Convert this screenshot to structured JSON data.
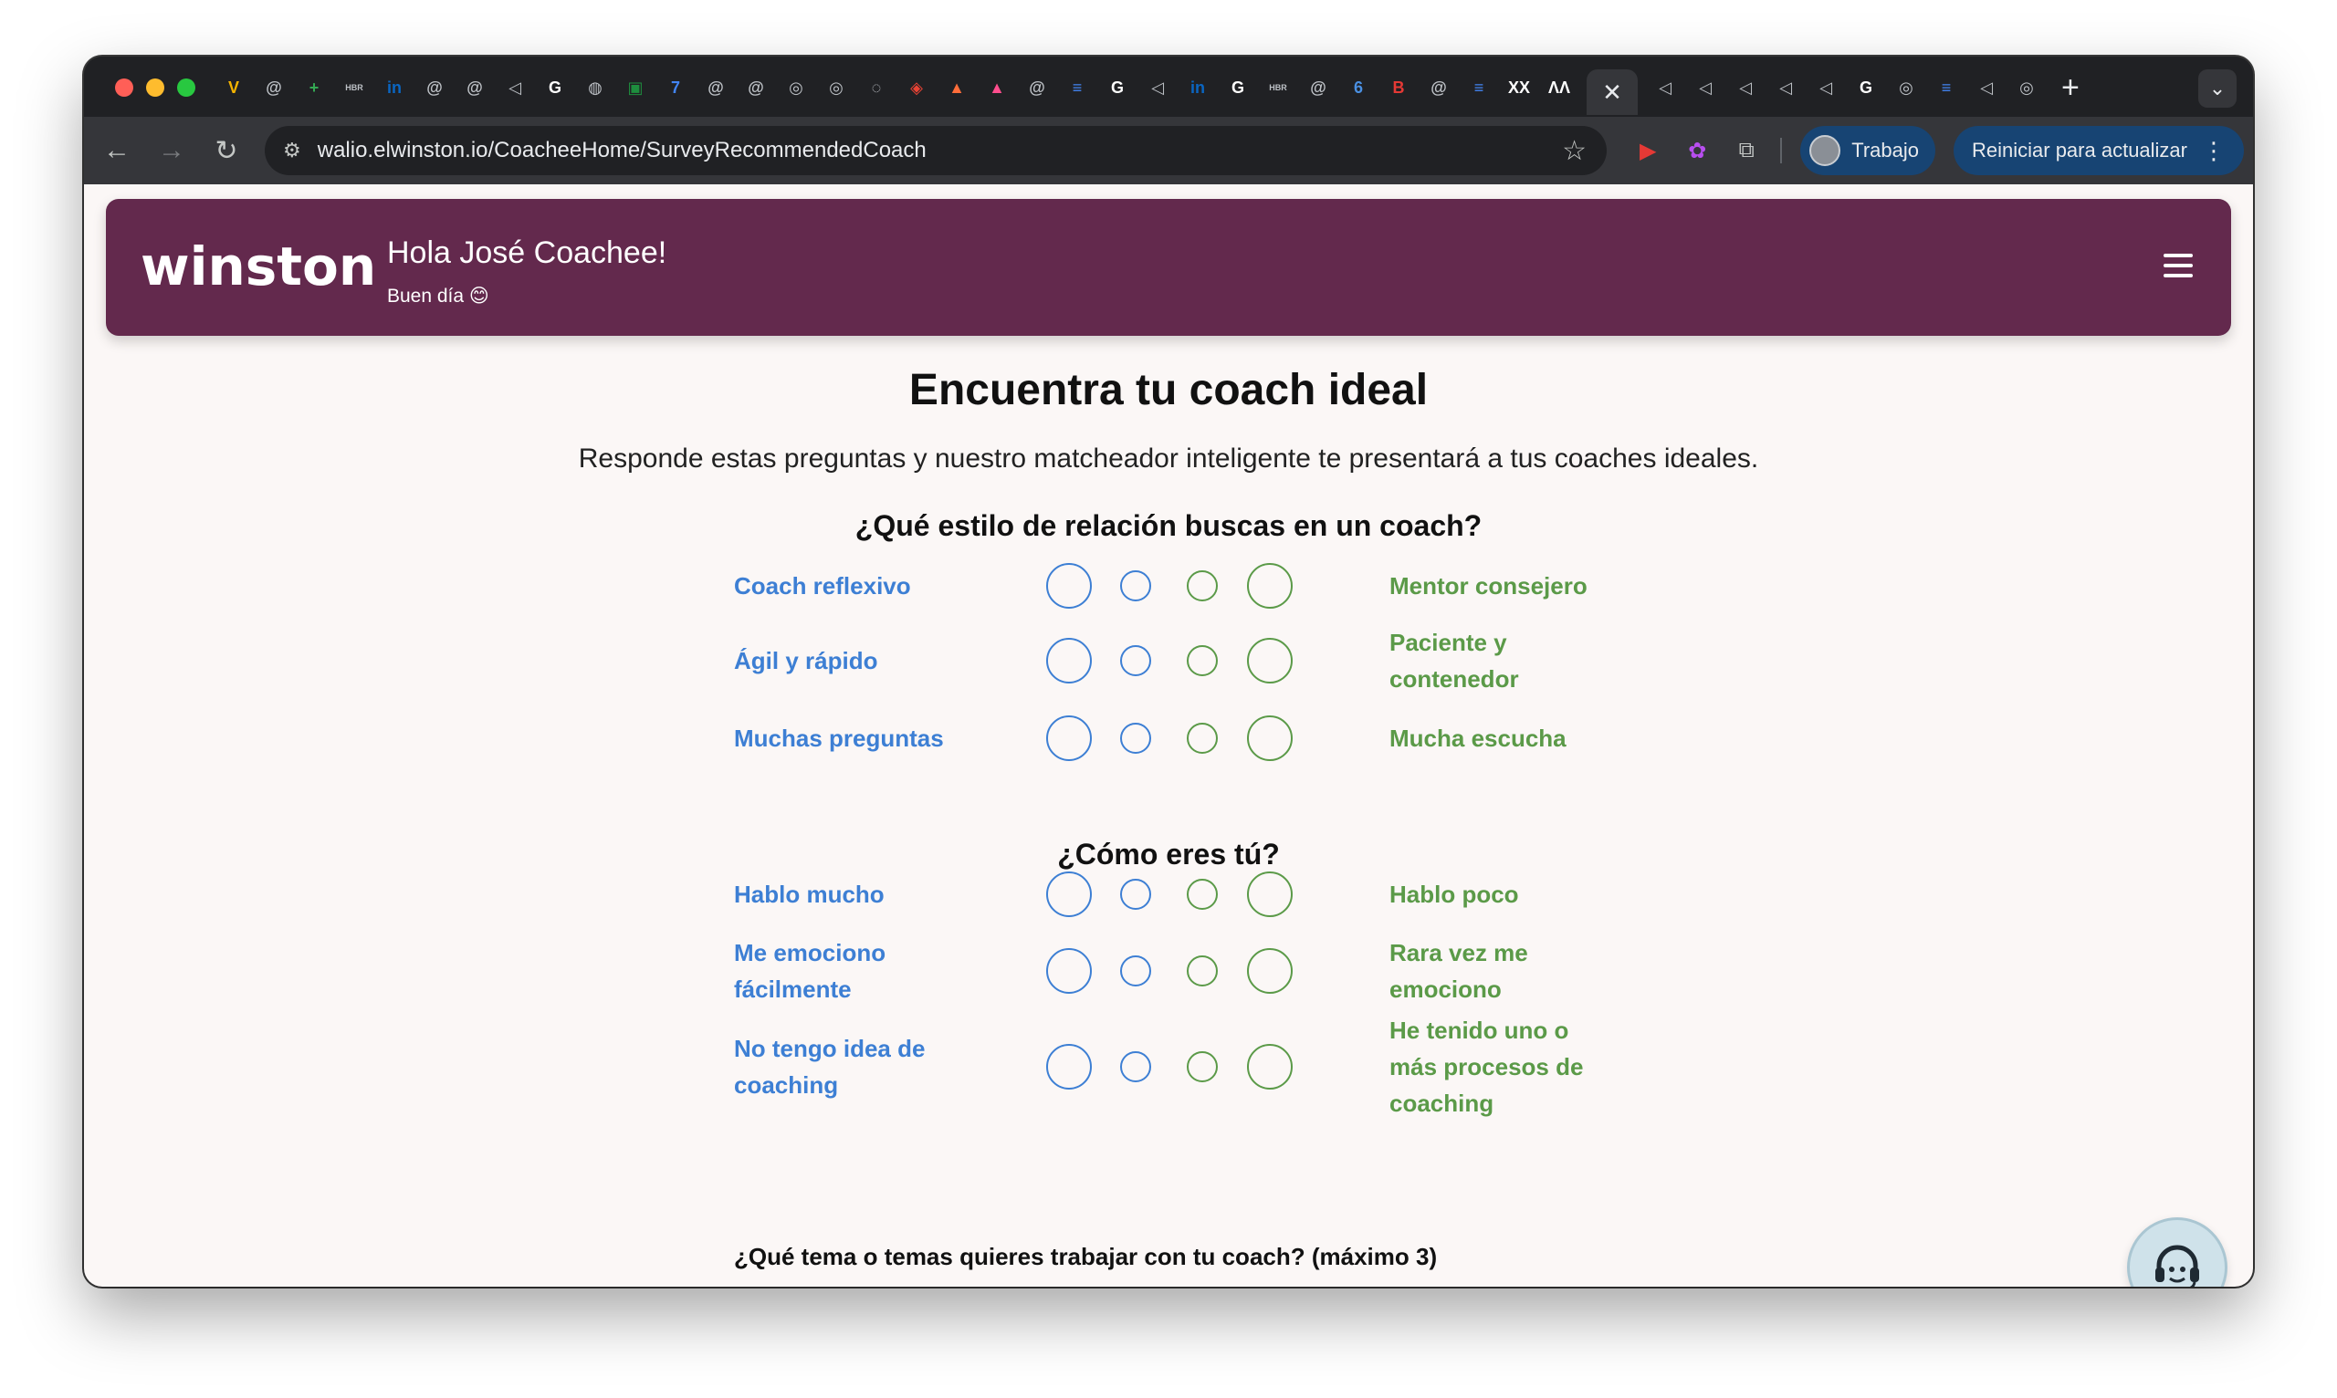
{
  "browser": {
    "url": "walio.elwinston.io/CoacheeHome/SurveyRecommendedCoach",
    "profile_label": "Trabajo",
    "update_label": "Reiniciar para actualizar",
    "tab_icons": [
      "V",
      "@",
      "+",
      "HBR",
      "in",
      "@",
      "@",
      "◁",
      "G",
      "◍",
      "▣",
      "7",
      "@",
      "@",
      "◎",
      "◎",
      "◌",
      "◈",
      "▲",
      "▲",
      "@",
      "≡",
      "G",
      "◁",
      "in",
      "G",
      "HBR",
      "@",
      "6",
      "B",
      "@",
      "≡",
      "XX",
      "ɅɅ"
    ],
    "tab_icons_after": [
      "◁",
      "◁",
      "◁",
      "◁",
      "◁",
      "G",
      "◎",
      "≡",
      "◁",
      "◎"
    ]
  },
  "header": {
    "logo": "winston",
    "greeting": "Hola José Coachee!",
    "subgreeting": "Buen día 😊"
  },
  "page": {
    "title": "Encuentra tu coach ideal",
    "subtitle": "Responde estas preguntas y nuestro matcheador inteligente te presentará a tus coaches ideales."
  },
  "sections": [
    {
      "title": "¿Qué estilo de relación buscas en un coach?",
      "rows": [
        {
          "left": "Coach reflexivo",
          "right": "Mentor consejero"
        },
        {
          "left": "Ágil y rápido",
          "right": "Paciente y contenedor"
        },
        {
          "left": "Muchas preguntas",
          "right": "Mucha escucha"
        }
      ]
    },
    {
      "title": "¿Cómo eres tú?",
      "rows": [
        {
          "left": "Hablo mucho",
          "right": "Hablo poco"
        },
        {
          "left": "Me emociono fácilmente",
          "right": "Rara vez me emociono"
        },
        {
          "left": "No tengo idea de coaching",
          "right": "He tenido uno o más procesos de coaching"
        }
      ]
    }
  ],
  "topics": {
    "label": "¿Qué tema o temas quieres trabajar con tu coach? (máximo 3)",
    "placeholder": "¿Qué tema o temas quieres trabajar con tu coach? (máximo 3)",
    "value": ""
  },
  "colors": {
    "brand": "#63294d",
    "left_accent": "#3d7fd4",
    "right_accent": "#5b9a48",
    "page_bg": "#fbf7f6"
  }
}
